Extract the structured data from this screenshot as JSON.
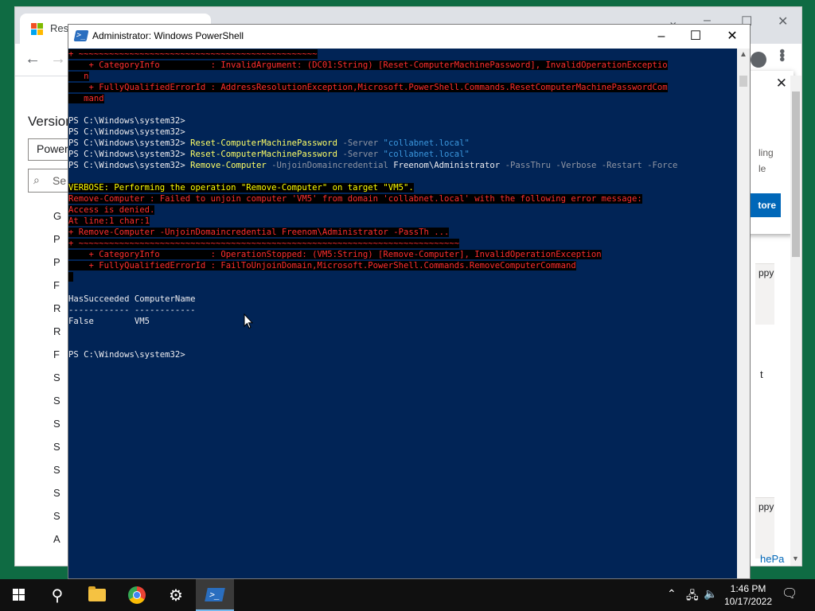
{
  "browser": {
    "tab_title": "Rese",
    "version_heading": "Version",
    "version_input": "Power",
    "search_placeholder": "Se",
    "side_letters": [
      "G",
      "P",
      "P",
      "F",
      "R",
      "R",
      "F",
      "S",
      "S",
      "S",
      "S",
      "S",
      "S",
      "S",
      "A"
    ],
    "popup_text_1": "ling",
    "popup_text_2": "le",
    "popup_button": "tore",
    "copy_label_1": "ppy",
    "copy_label_2": "ppy",
    "right_text": "t",
    "right_link": "hePa"
  },
  "powershell": {
    "title": "Administrator: Windows PowerShell",
    "lines": {
      "l0": "+ ~~~~~~~~~~~~~~~~~~~~~~~~~~~~~~~~~~~~~~~~~~~~~~~",
      "l1": "    + CategoryInfo          : InvalidArgument: (DC01:String) [Reset-ComputerMachinePassword], InvalidOperationExceptio",
      "l2": "   n",
      "l3": "    + FullyQualifiedErrorId : AddressResolutionException,Microsoft.PowerShell.Commands.ResetComputerMachinePasswordCom",
      "l4": "   mand",
      "p1": "PS C:\\Windows\\system32>",
      "p2": "PS C:\\Windows\\system32>",
      "p3": "PS C:\\Windows\\system32>",
      "p4": "PS C:\\Windows\\system32>",
      "p5": "PS C:\\Windows\\system32>",
      "reset_cmd": "Reset-ComputerMachinePassword",
      "server_param": "-Server",
      "server_value": "\"collabnet.local\"",
      "remove_cmd": "Remove-Computer",
      "unjoin_param": "-UnjoinDomaincredential",
      "unjoin_value": "Freenom\\Administrator",
      "remove_flags": "-PassThru -Verbose -Restart -Force",
      "verbose": "VERBOSE: Performing the operation \"Remove-Computer\" on target \"VM5\".",
      "err1": "Remove-Computer : Failed to unjoin computer 'VM5' from domain 'collabnet.local' with the following error message:",
      "err2": "Access is denied.",
      "err3": "At line:1 char:1",
      "err4": "+ Remove-Computer -UnjoinDomaincredential Freenom\\Administrator -PassTh ...",
      "err5": "+ ~~~~~~~~~~~~~~~~~~~~~~~~~~~~~~~~~~~~~~~~~~~~~~~~~~~~~~~~~~~~~~~~~~~~~~~~~~~",
      "err6": "    + CategoryInfo          : OperationStopped: (VM5:String) [Remove-Computer], InvalidOperationException",
      "err7": "    + FullyQualifiedErrorId : FailToUnjoinDomain,Microsoft.PowerShell.Commands.RemoveComputerCommand",
      "hdr": "HasSucceeded ComputerName",
      "sep": "------------ ------------",
      "row": "False        VM5",
      "final_prompt": "PS C:\\Windows\\system32>"
    }
  },
  "taskbar": {
    "time": "1:46 PM",
    "date": "10/17/2022"
  },
  "colors": {
    "ps_background": "#012456",
    "error_red": "#ff2e2e",
    "verbose_yellow": "#ffff00",
    "cmdlet_yellow": "#ffff66",
    "parameter_gray": "#8f95a3",
    "string_blue": "#3a96dd"
  }
}
